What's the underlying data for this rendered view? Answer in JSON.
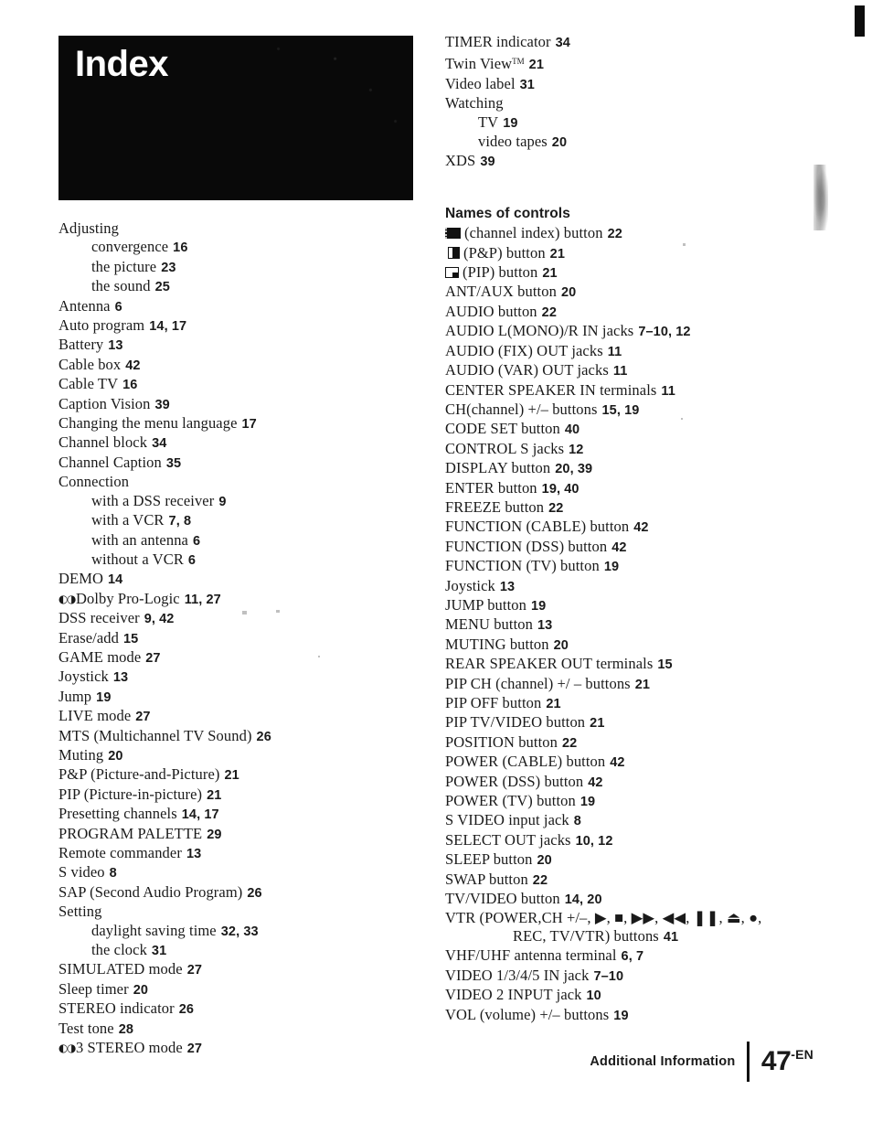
{
  "banner": {
    "title": "Index"
  },
  "footer": {
    "section_label": "Additional Information",
    "page_number": "47",
    "language_suffix": "-EN"
  },
  "left_column": [
    {
      "level": 1,
      "text": "Adjusting",
      "pages": ""
    },
    {
      "level": 2,
      "text": "convergence",
      "pages": "16"
    },
    {
      "level": 2,
      "text": "the picture",
      "pages": "23"
    },
    {
      "level": 2,
      "text": "the sound",
      "pages": "25"
    },
    {
      "level": 1,
      "text": "Antenna",
      "pages": "6"
    },
    {
      "level": 1,
      "text": "Auto program",
      "pages": "14, 17"
    },
    {
      "level": 1,
      "text": "Battery",
      "pages": "13"
    },
    {
      "level": 1,
      "text": "Cable box",
      "pages": "42"
    },
    {
      "level": 1,
      "text": "Cable TV",
      "pages": "16"
    },
    {
      "level": 1,
      "text": "Caption Vision",
      "pages": "39"
    },
    {
      "level": 1,
      "text": "Changing the menu language",
      "pages": "17"
    },
    {
      "level": 1,
      "text": "Channel block",
      "pages": "34"
    },
    {
      "level": 1,
      "text": "Channel Caption",
      "pages": "35"
    },
    {
      "level": 1,
      "text": "Connection",
      "pages": ""
    },
    {
      "level": 2,
      "text": "with a DSS receiver",
      "pages": "9"
    },
    {
      "level": 2,
      "text": "with a VCR",
      "pages": "7, 8"
    },
    {
      "level": 2,
      "text": "with an antenna",
      "pages": "6"
    },
    {
      "level": 2,
      "text": "without a VCR",
      "pages": "6"
    },
    {
      "level": 1,
      "text": "DEMO",
      "pages": "14"
    },
    {
      "level": 1,
      "text": "Dolby Pro-Logic",
      "pages": "11, 27",
      "prefix_icon": "dolby-logo"
    },
    {
      "level": 1,
      "text": "DSS receiver",
      "pages": "9, 42"
    },
    {
      "level": 1,
      "text": "Erase/add",
      "pages": "15"
    },
    {
      "level": 1,
      "text": "GAME mode",
      "pages": "27"
    },
    {
      "level": 1,
      "text": "Joystick",
      "pages": "13"
    },
    {
      "level": 1,
      "text": "Jump",
      "pages": "19"
    },
    {
      "level": 1,
      "text": "LIVE mode",
      "pages": "27"
    },
    {
      "level": 1,
      "text": "MTS (Multichannel TV Sound)",
      "pages": "26"
    },
    {
      "level": 1,
      "text": "Muting",
      "pages": "20"
    },
    {
      "level": 1,
      "text": "P&P (Picture-and-Picture)",
      "pages": "21"
    },
    {
      "level": 1,
      "text": "PIP (Picture-in-picture)",
      "pages": "21"
    },
    {
      "level": 1,
      "text": "Presetting channels",
      "pages": "14, 17"
    },
    {
      "level": 1,
      "text": "PROGRAM PALETTE",
      "pages": "29"
    },
    {
      "level": 1,
      "text": "Remote commander",
      "pages": "13"
    },
    {
      "level": 1,
      "text": "S video",
      "pages": "8"
    },
    {
      "level": 1,
      "text": "SAP (Second Audio Program)",
      "pages": "26"
    },
    {
      "level": 1,
      "text": "Setting",
      "pages": ""
    },
    {
      "level": 2,
      "text": "daylight saving time",
      "pages": "32, 33"
    },
    {
      "level": 2,
      "text": "the clock",
      "pages": "31"
    },
    {
      "level": 1,
      "text": "SIMULATED mode",
      "pages": "27"
    },
    {
      "level": 1,
      "text": "Sleep timer",
      "pages": "20"
    },
    {
      "level": 1,
      "text": "STEREO indicator",
      "pages": "26"
    },
    {
      "level": 1,
      "text": "Test tone",
      "pages": "28"
    },
    {
      "level": 1,
      "text": "3 STEREO mode",
      "pages": "27",
      "prefix_icon": "dolby-logo"
    }
  ],
  "right_column_top": [
    {
      "level": 1,
      "text": "TIMER indicator",
      "pages": "34"
    },
    {
      "level": 1,
      "text": "Twin View",
      "pages": "21",
      "suffix": "TM"
    },
    {
      "level": 1,
      "text": "Video label",
      "pages": "31"
    },
    {
      "level": 1,
      "text": "Watching",
      "pages": ""
    },
    {
      "level": 2,
      "text": "TV",
      "pages": "19"
    },
    {
      "level": 2,
      "text": "video tapes",
      "pages": "20"
    },
    {
      "level": 1,
      "text": "XDS",
      "pages": "39"
    }
  ],
  "names_of_controls": {
    "heading": "Names of controls",
    "entries": [
      {
        "level": 1,
        "icon": "channel-index-glyph",
        "text": "(channel index) button",
        "pages": "22"
      },
      {
        "level": 1,
        "icon": "pnp-glyph",
        "text": "(P&P) button",
        "pages": "21"
      },
      {
        "level": 1,
        "icon": "pip-glyph",
        "text": "(PIP) button",
        "pages": "21"
      },
      {
        "level": 1,
        "text": "ANT/AUX button",
        "pages": "20"
      },
      {
        "level": 1,
        "text": "AUDIO button",
        "pages": "22"
      },
      {
        "level": 1,
        "text": "AUDIO L(MONO)/R IN jacks",
        "pages": "7–10, 12"
      },
      {
        "level": 1,
        "text": "AUDIO (FIX) OUT jacks",
        "pages": "11"
      },
      {
        "level": 1,
        "text": "AUDIO (VAR) OUT jacks",
        "pages": "11"
      },
      {
        "level": 1,
        "text": "CENTER SPEAKER IN terminals",
        "pages": "11"
      },
      {
        "level": 1,
        "text": "CH(channel) +/– buttons",
        "pages": "15, 19"
      },
      {
        "level": 1,
        "text": "CODE SET button",
        "pages": "40"
      },
      {
        "level": 1,
        "text": "CONTROL S jacks",
        "pages": "12"
      },
      {
        "level": 1,
        "text": "DISPLAY button",
        "pages": "20, 39"
      },
      {
        "level": 1,
        "text": "ENTER button",
        "pages": "19, 40"
      },
      {
        "level": 1,
        "text": "FREEZE button",
        "pages": "22"
      },
      {
        "level": 1,
        "text": "FUNCTION (CABLE) button",
        "pages": "42"
      },
      {
        "level": 1,
        "text": "FUNCTION (DSS) button",
        "pages": "42"
      },
      {
        "level": 1,
        "text": "FUNCTION (TV) button",
        "pages": "19"
      },
      {
        "level": 1,
        "text": "Joystick",
        "pages": "13"
      },
      {
        "level": 1,
        "text": "JUMP button",
        "pages": "19"
      },
      {
        "level": 1,
        "text": "MENU button",
        "pages": "13"
      },
      {
        "level": 1,
        "text": "MUTING button",
        "pages": "20"
      },
      {
        "level": 1,
        "text": "REAR SPEAKER OUT terminals",
        "pages": "15"
      },
      {
        "level": 1,
        "text": "PIP CH (channel) +/ – buttons",
        "pages": "21"
      },
      {
        "level": 1,
        "text": "PIP OFF button",
        "pages": "21"
      },
      {
        "level": 1,
        "text": "PIP TV/VIDEO button",
        "pages": "21"
      },
      {
        "level": 1,
        "text": "POSITION button",
        "pages": "22"
      },
      {
        "level": 1,
        "text": "POWER (CABLE) button",
        "pages": "42"
      },
      {
        "level": 1,
        "text": "POWER (DSS) button",
        "pages": "42"
      },
      {
        "level": 1,
        "text": "POWER (TV) button",
        "pages": "19"
      },
      {
        "level": 1,
        "text": "S VIDEO input jack",
        "pages": "8"
      },
      {
        "level": 1,
        "text": "SELECT OUT jacks",
        "pages": "10, 12"
      },
      {
        "level": 1,
        "text": "SLEEP button",
        "pages": "20"
      },
      {
        "level": 1,
        "text": "SWAP button",
        "pages": "22"
      },
      {
        "level": 1,
        "text": "TV/VIDEO button",
        "pages": "14, 20"
      },
      {
        "level": 1,
        "text": "VTR (POWER,CH +/–, ▶, ■, ▶▶, ◀◀, ❚❚, ⏏, ●,",
        "continuation": "REC, TV/VTR) buttons",
        "pages": "41"
      },
      {
        "level": 1,
        "text": "VHF/UHF antenna terminal",
        "pages": "6, 7"
      },
      {
        "level": 1,
        "text": "VIDEO 1/3/4/5 IN jack",
        "pages": "7–10"
      },
      {
        "level": 1,
        "text": "VIDEO 2 INPUT jack",
        "pages": "10"
      },
      {
        "level": 1,
        "text": "VOL (volume) +/– buttons",
        "pages": "19"
      }
    ]
  }
}
